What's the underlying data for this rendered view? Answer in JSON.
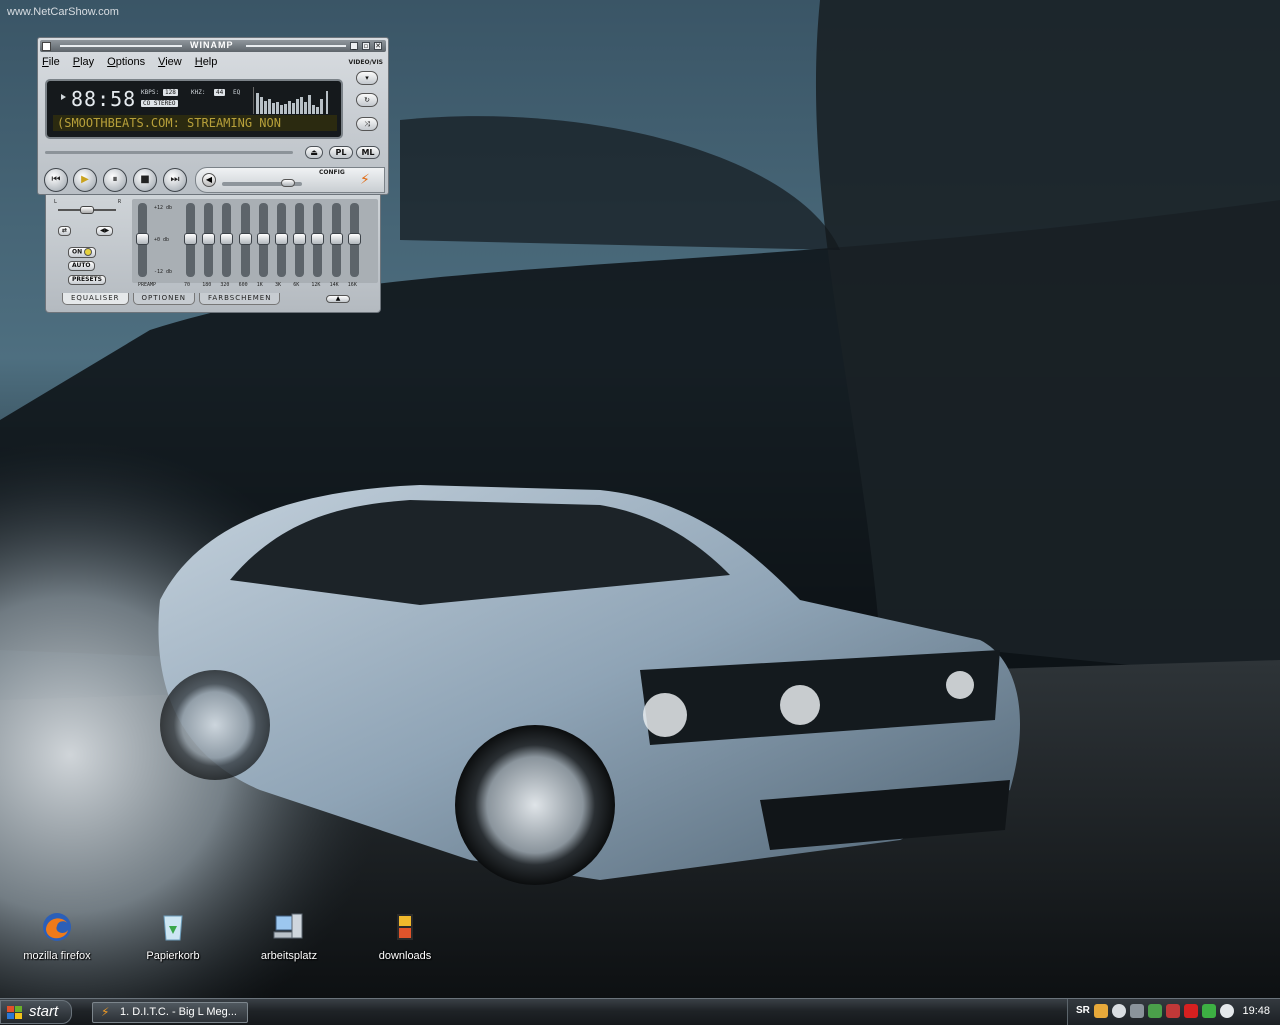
{
  "desktop": {
    "watermark": "www.NetCarShow.com",
    "icons": [
      {
        "label": "mozilla firefox"
      },
      {
        "label": "Papierkorb"
      },
      {
        "label": "arbeitsplatz"
      },
      {
        "label": "downloads"
      }
    ]
  },
  "winamp": {
    "title": "WINAMP",
    "menu": [
      "File",
      "Play",
      "Options",
      "View",
      "Help"
    ],
    "video_vis_label": "VIDEO/VIS",
    "time": "88:58",
    "kbps_label": "KBPS:",
    "kbps": "128",
    "khz_label": "KHZ:",
    "khz": "44",
    "eq_label": "EQ",
    "stereo": "CO STEREO",
    "ticker": "(SMOOTHBEATS.COM: STREAMING NON",
    "pl_label": "PL",
    "ml_label": "ML",
    "config_label": "CONFIG",
    "volume_level": 0.9
  },
  "equalizer": {
    "balance_left": "L",
    "balance_right": "R",
    "on_label": "ON",
    "auto_label": "AUTO",
    "presets_label": "PRESETS",
    "db_top": "+12 db",
    "db_mid": "+0 db",
    "db_bottom": "-12 db",
    "preamp_label": "PREAMP",
    "bands": [
      "70",
      "180",
      "320",
      "600",
      "1K",
      "3K",
      "6K",
      "12K",
      "14K",
      "16K"
    ],
    "tabs": [
      "EQUALISER",
      "OPTIONEN",
      "FARBSCHEMEN"
    ]
  },
  "taskbar": {
    "start_label": "start",
    "task_item": "1. D.I.T.C. - Big L Meg...",
    "clock": "19:48"
  },
  "colors": {
    "ticker_text": "#b7a03a",
    "taskbar": "#1f2327",
    "car_body": "#8fa4b6"
  }
}
